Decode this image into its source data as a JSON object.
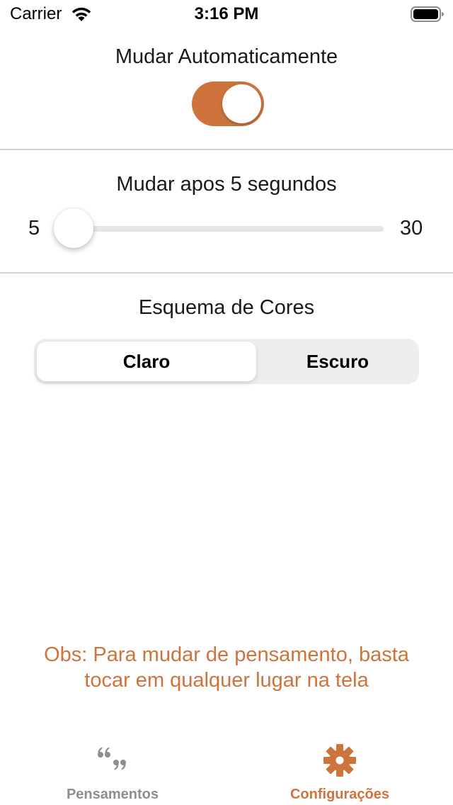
{
  "status_bar": {
    "carrier": "Carrier",
    "time": "3:16 PM"
  },
  "settings": {
    "auto_change": {
      "label": "Mudar Automaticamente",
      "enabled": true
    },
    "interval": {
      "label": "Mudar apos 5 segundos",
      "min_label": "5",
      "max_label": "30",
      "min": 5,
      "max": 30,
      "value": 5
    },
    "color_scheme": {
      "label": "Esquema de Cores",
      "options": [
        "Claro",
        "Escuro"
      ],
      "selected": "Claro"
    }
  },
  "note": "Obs: Para mudar de pensamento, basta tocar em qualquer lugar na tela",
  "tab_bar": {
    "items": [
      {
        "label": "Pensamentos",
        "icon": "quote-icon",
        "selected": false
      },
      {
        "label": "Configurações",
        "icon": "gear-icon",
        "selected": true
      }
    ]
  },
  "colors": {
    "accent": "#cf733c",
    "inactive": "#8e8e8e"
  }
}
